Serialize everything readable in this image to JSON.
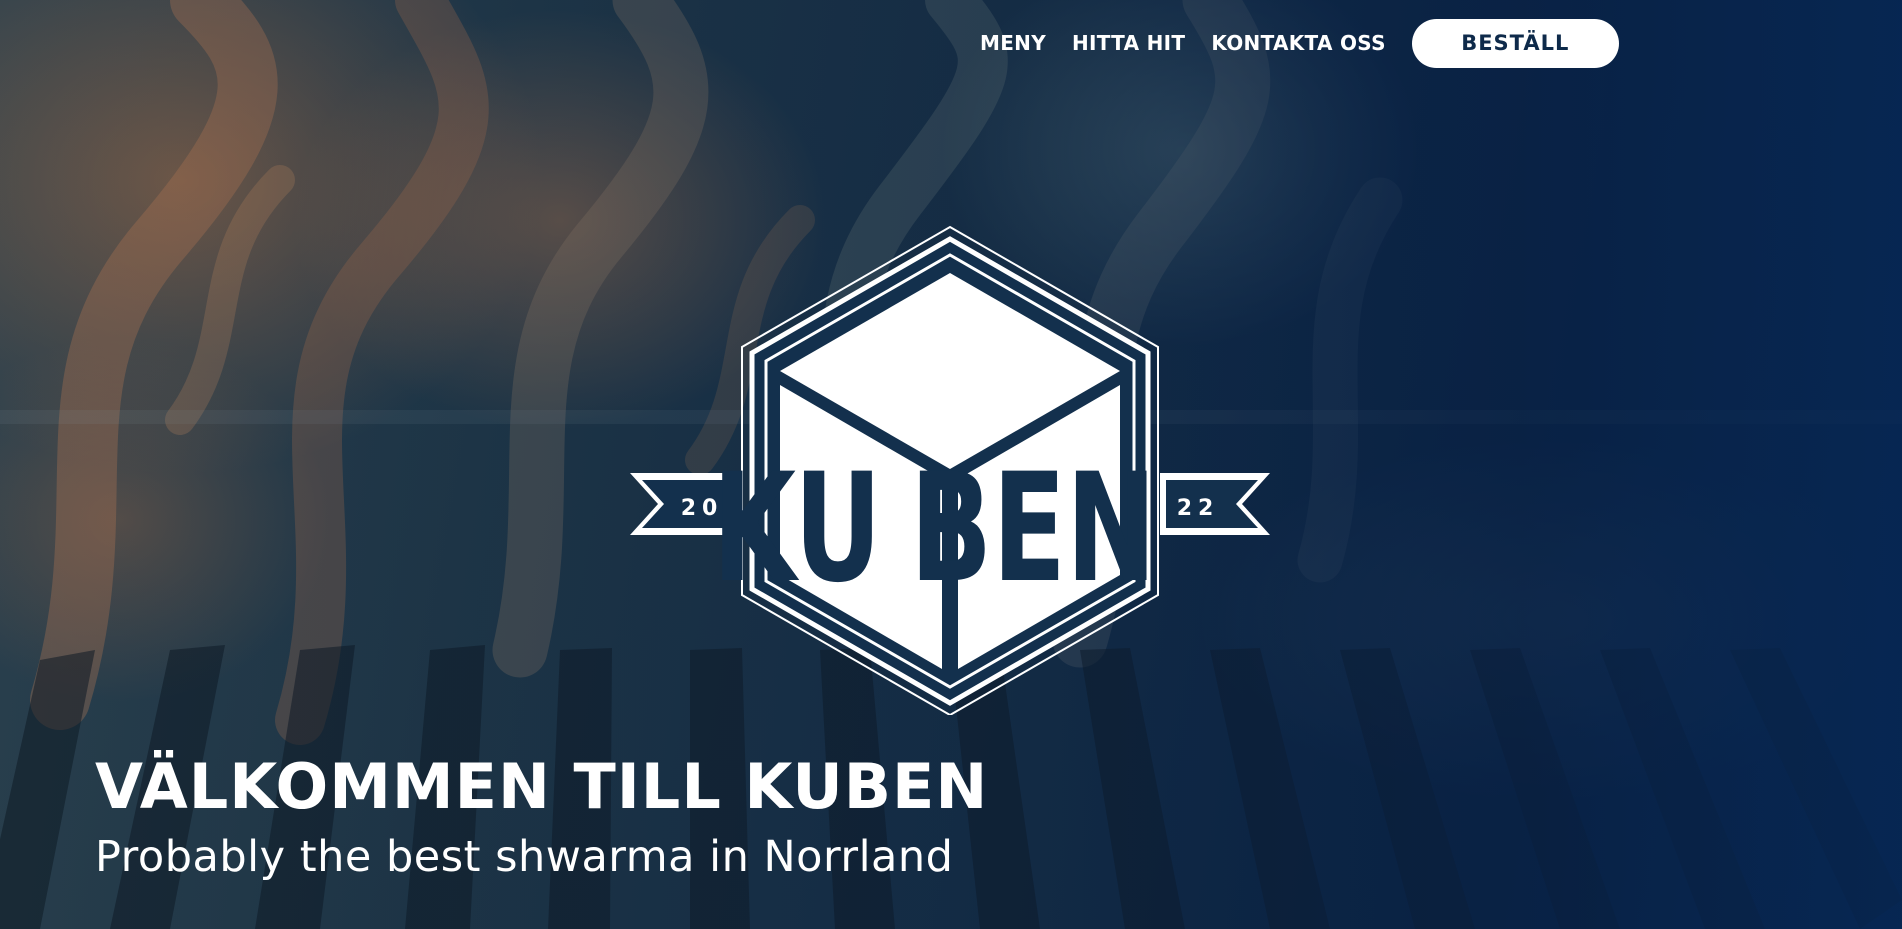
{
  "nav": {
    "items": [
      {
        "label": "MENY"
      },
      {
        "label": "HITTA HIT"
      },
      {
        "label": "KONTAKTA OSS"
      }
    ],
    "order_button": "BESTÄLL"
  },
  "logo": {
    "name": "KUBEN",
    "year_left": "20",
    "year_right": "22",
    "icon": "kuben-cube-logo"
  },
  "hero": {
    "headline": "VÄLKOMMEN TILL KUBEN",
    "tagline": "Probably the best shwarma in Norrland",
    "background": "flames-over-grill-photo"
  },
  "colors": {
    "brand_navy": "#0e2a4a",
    "text_white": "#ffffff"
  }
}
